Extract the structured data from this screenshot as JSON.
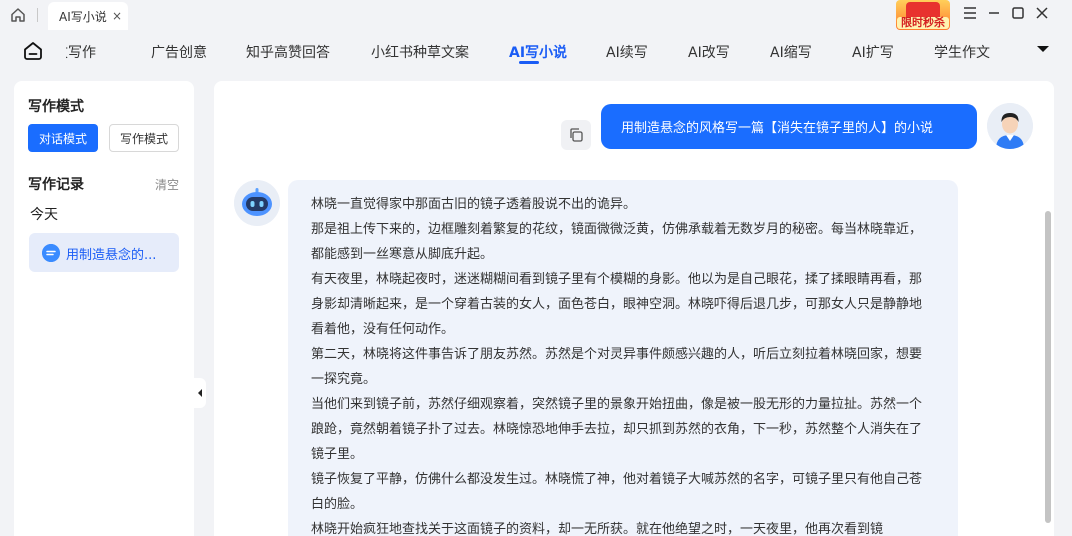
{
  "titlebar": {
    "tab_label": "AI写小说",
    "tab_close": "×",
    "promo_label": "限时秒杀",
    "icons": [
      "home-icon",
      "menu-icon",
      "minimize-icon",
      "maximize-icon",
      "close-icon"
    ]
  },
  "nav": {
    "items": [
      "论文写作",
      "广告创意",
      "知乎高赞回答",
      "小红书种草文案",
      "AI写小说",
      "AI续写",
      "AI改写",
      "AI缩写",
      "AI扩写",
      "学生作文"
    ],
    "active": "AI写小说"
  },
  "sidebar": {
    "mode_title": "写作模式",
    "mode_chat": "对话模式",
    "mode_write": "写作模式",
    "records_title": "写作记录",
    "clear_label": "清空",
    "today_label": "今天",
    "history_item": "用制造悬念的..."
  },
  "chat": {
    "user_prompt": "用制造悬念的风格写一篇【消失在镜子里的人】的小说",
    "answer_paragraphs": [
      "林晓一直觉得家中那面古旧的镜子透着股说不出的诡异。",
      "那是祖上传下来的，边框雕刻着繁复的花纹，镜面微微泛黄，仿佛承载着无数岁月的秘密。每当林晓靠近，都能感到一丝寒意从脚底升起。",
      "有天夜里，林晓起夜时，迷迷糊糊间看到镜子里有个模糊的身影。他以为是自己眼花，揉了揉眼睛再看，那身影却清晰起来，是一个穿着古装的女人，面色苍白，眼神空洞。林晓吓得后退几步，可那女人只是静静地看着他，没有任何动作。",
      "第二天，林晓将这件事告诉了朋友苏然。苏然是个对灵异事件颇感兴趣的人，听后立刻拉着林晓回家，想要一探究竟。",
      "当他们来到镜子前，苏然仔细观察着，突然镜子里的景象开始扭曲，像是被一股无形的力量拉扯。苏然一个踉跄，竟然朝着镜子扑了过去。林晓惊恐地伸手去拉，却只抓到苏然的衣角，下一秒，苏然整个人消失在了镜子里。",
      "镜子恢复了平静，仿佛什么都没发生过。林晓慌了神，他对着镜子大喊苏然的名字，可镜子里只有他自己苍白的脸。",
      "林晓开始疯狂地查找关于这面镜子的资料，却一无所获。就在他绝望之时，一天夜里，他再次看到镜"
    ]
  },
  "colors": {
    "accent": "#1a6dff",
    "nav_active": "#1a5cf5",
    "answer_bg": "#eff3fb",
    "sidebar_item_bg": "#e6ecfa"
  }
}
